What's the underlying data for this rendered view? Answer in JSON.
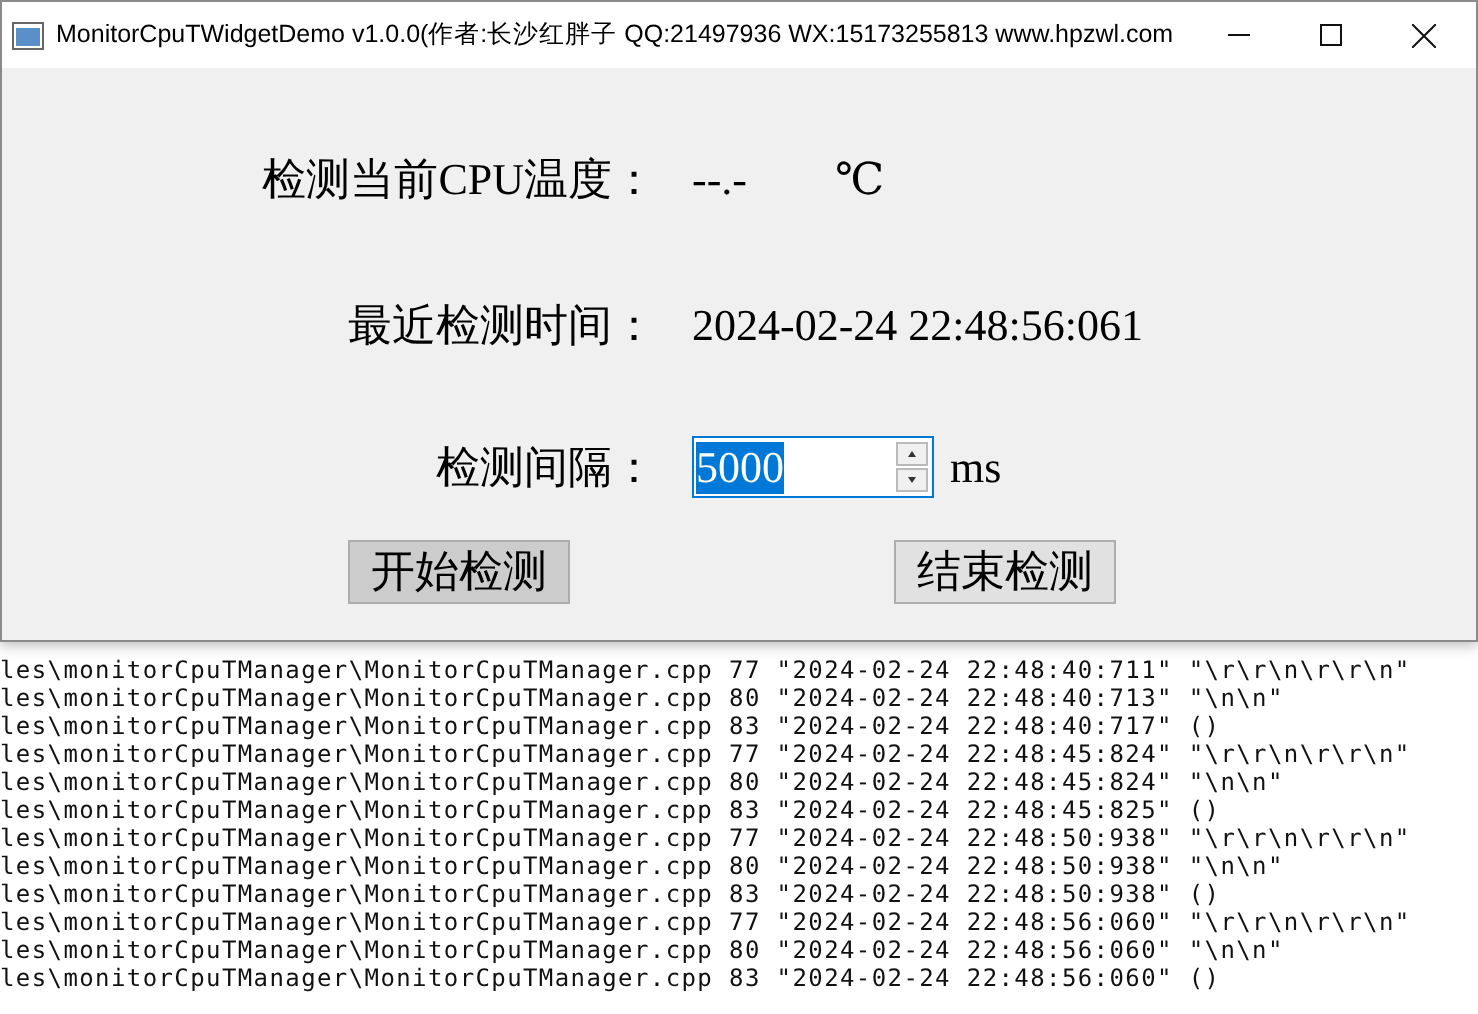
{
  "window": {
    "title": "MonitorCpuTWidgetDemo v1.0.0(作者:长沙红胖子 QQ:21497936 WX:15173255813 www.hpzwl.com"
  },
  "temperature": {
    "label": "检测当前CPU温度：",
    "value": "--.-",
    "unit": "℃"
  },
  "last_time": {
    "label": "最近检测时间：",
    "value": "2024-02-24 22:48:56:061"
  },
  "interval": {
    "label": "检测间隔：",
    "value": "5000",
    "text_selected": true,
    "unit": "ms"
  },
  "buttons": [
    {
      "label": "开始检测",
      "highlighted": true
    },
    {
      "label": "结束检测",
      "highlighted": false
    }
  ],
  "console_lines": [
    "les\\monitorCpuTManager\\MonitorCpuTManager.cpp 77 \"2024-02-24 22:48:40:711\" \"\\r\\r\\n\\r\\r\\n\"",
    "les\\monitorCpuTManager\\MonitorCpuTManager.cpp 80 \"2024-02-24 22:48:40:713\" \"\\n\\n\"",
    "les\\monitorCpuTManager\\MonitorCpuTManager.cpp 83 \"2024-02-24 22:48:40:717\" ()",
    "les\\monitorCpuTManager\\MonitorCpuTManager.cpp 77 \"2024-02-24 22:48:45:824\" \"\\r\\r\\n\\r\\r\\n\"",
    "les\\monitorCpuTManager\\MonitorCpuTManager.cpp 80 \"2024-02-24 22:48:45:824\" \"\\n\\n\"",
    "les\\monitorCpuTManager\\MonitorCpuTManager.cpp 83 \"2024-02-24 22:48:45:825\" ()",
    "les\\monitorCpuTManager\\MonitorCpuTManager.cpp 77 \"2024-02-24 22:48:50:938\" \"\\r\\r\\n\\r\\r\\n\"",
    "les\\monitorCpuTManager\\MonitorCpuTManager.cpp 80 \"2024-02-24 22:48:50:938\" \"\\n\\n\"",
    "les\\monitorCpuTManager\\MonitorCpuTManager.cpp 83 \"2024-02-24 22:48:50:938\" ()",
    "les\\monitorCpuTManager\\MonitorCpuTManager.cpp 77 \"2024-02-24 22:48:56:060\" \"\\r\\r\\n\\r\\r\\n\"",
    "les\\monitorCpuTManager\\MonitorCpuTManager.cpp 80 \"2024-02-24 22:48:56:060\" \"\\n\\n\"",
    "les\\monitorCpuTManager\\MonitorCpuTManager.cpp 83 \"2024-02-24 22:48:56:060\" ()"
  ]
}
